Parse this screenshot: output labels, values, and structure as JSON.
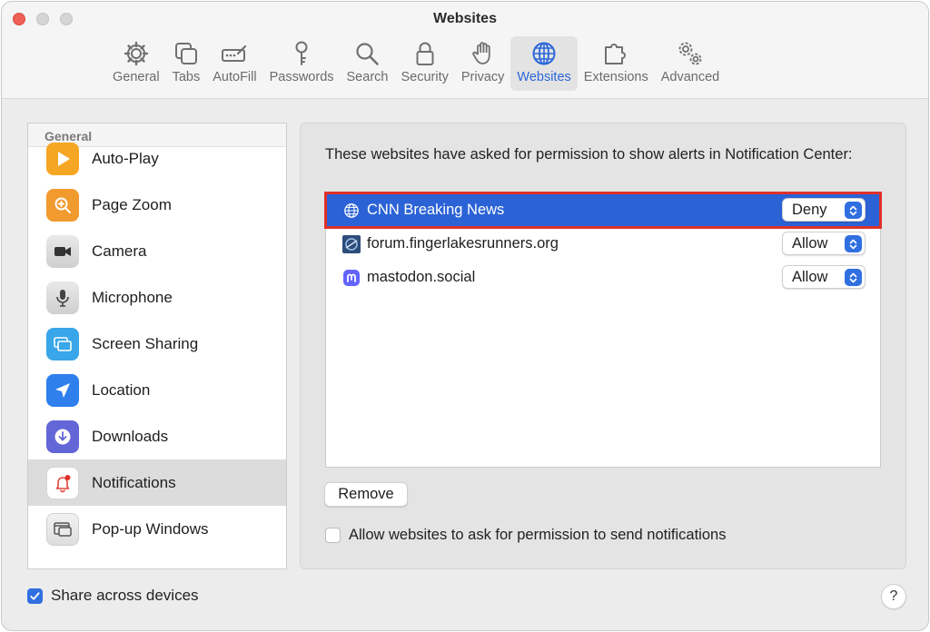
{
  "window": {
    "title": "Websites"
  },
  "toolbar": {
    "tabs": [
      {
        "label": "General",
        "icon": "gear-icon"
      },
      {
        "label": "Tabs",
        "icon": "tabs-icon"
      },
      {
        "label": "AutoFill",
        "icon": "autofill-icon"
      },
      {
        "label": "Passwords",
        "icon": "key-icon"
      },
      {
        "label": "Search",
        "icon": "magnifier-icon"
      },
      {
        "label": "Security",
        "icon": "lock-icon"
      },
      {
        "label": "Privacy",
        "icon": "hand-icon"
      },
      {
        "label": "Websites",
        "icon": "globe-icon",
        "active": true
      },
      {
        "label": "Extensions",
        "icon": "puzzle-icon"
      },
      {
        "label": "Advanced",
        "icon": "gears-icon"
      }
    ]
  },
  "sidebar": {
    "header": "General",
    "items": [
      {
        "label": "Auto-Play",
        "icon": "play-icon",
        "color": "#f5a623"
      },
      {
        "label": "Page Zoom",
        "icon": "zoom-icon",
        "color": "#f19a2e"
      },
      {
        "label": "Camera",
        "icon": "camera-icon",
        "color": "#5a5a5a"
      },
      {
        "label": "Microphone",
        "icon": "microphone-icon",
        "color": "#8e8e8e"
      },
      {
        "label": "Screen Sharing",
        "icon": "screen-sharing-icon",
        "color": "#38a6e8"
      },
      {
        "label": "Location",
        "icon": "location-arrow-icon",
        "color": "#2f80ed"
      },
      {
        "label": "Downloads",
        "icon": "download-icon",
        "color": "#6366d6"
      },
      {
        "label": "Notifications",
        "icon": "bell-icon",
        "color": "#ffffff",
        "selected": true
      },
      {
        "label": "Pop-up Windows",
        "icon": "popup-window-icon",
        "color": "#e8e8e8"
      }
    ]
  },
  "panel": {
    "description": "These websites have asked for permission to show alerts in Notification Center:",
    "sites": [
      {
        "name": "CNN Breaking News",
        "setting": "Deny",
        "icon": "globe-icon",
        "selected": true
      },
      {
        "name": "forum.fingerlakesrunners.org",
        "setting": "Allow",
        "icon": "site-favicon-icon"
      },
      {
        "name": "mastodon.social",
        "setting": "Allow",
        "icon": "mastodon-icon"
      }
    ],
    "remove_label": "Remove",
    "allow_ask_label": "Allow websites to ask for permission to send notifications",
    "allow_ask_checked": false
  },
  "footer": {
    "share_label": "Share across devices",
    "share_checked": true,
    "help_label": "?"
  },
  "colors": {
    "accent": "#2f6fe0",
    "selection": "#2b62d6",
    "highlight_outline": "#e0302a"
  }
}
